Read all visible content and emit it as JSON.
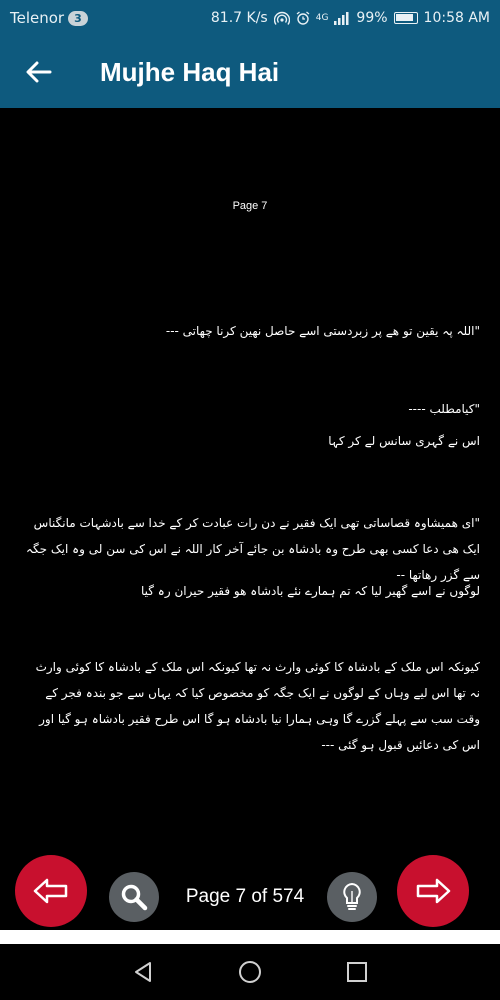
{
  "status": {
    "carrier": "Telenor",
    "sim_badge": "3",
    "speed": "81.7 K/s",
    "network": "4G",
    "battery": "99%",
    "time": "10:58 AM"
  },
  "app_bar": {
    "title": "Mujhe Haq Hai"
  },
  "page": {
    "label": "Page 7",
    "paragraphs": [
      "\"اللہ پہ یقین تو ھے پر زبردستی اسے حاصل نھین کرنا چھاتی ---",
      "\"کیامطلب ----",
      "اس نے گہری سانس لے کر کہا",
      "\"ای ھمیشاوہ قصاساتی تھی ایک فقیر نے دن رات عبادت کر کے خدا سے بادشہات مانگناس ایک ھی دعا کسی بھی طرح وہ بادشاہ بن جائے آخر کار اللہ نے اس کی سن لی وہ ایک جگہ سے گزر رھاتھا --",
      "لوگوں نے اسے گھیر لیا کہ تم ہمارے نئے بادشاہ ھو فقیر حیران رہ گیا",
      "کیونکہ اس ملک کے بادشاہ کا کوئی وارث نہ تھا کیونکہ اس ملک کے بادشاہ کا کوئی وارث نہ تھا اس لیے وہاں کے لوگوں نے ایک جگہ کو مخصوص کیا کہ یہاں سے جو بندہ فجر کے وقت سب سے پہلے گزرے گا وہی ہمارا نیا بادشاہ ہو گا اس طرح فقیر بادشاہ ہو گیا اور اس کی دعائیں قبول ہو گئی ---"
    ]
  },
  "controls": {
    "page_counter": "Page 7 of 574"
  },
  "icons": {
    "back": "arrow-left-icon",
    "prev": "arrow-left-outline-icon",
    "search": "search-icon",
    "hint": "lightbulb-icon",
    "next": "arrow-right-outline-icon"
  },
  "colors": {
    "header": "#0e5a7e",
    "nav_button": "#c8102e",
    "round_button": "#5a5f63",
    "background": "#000000"
  }
}
